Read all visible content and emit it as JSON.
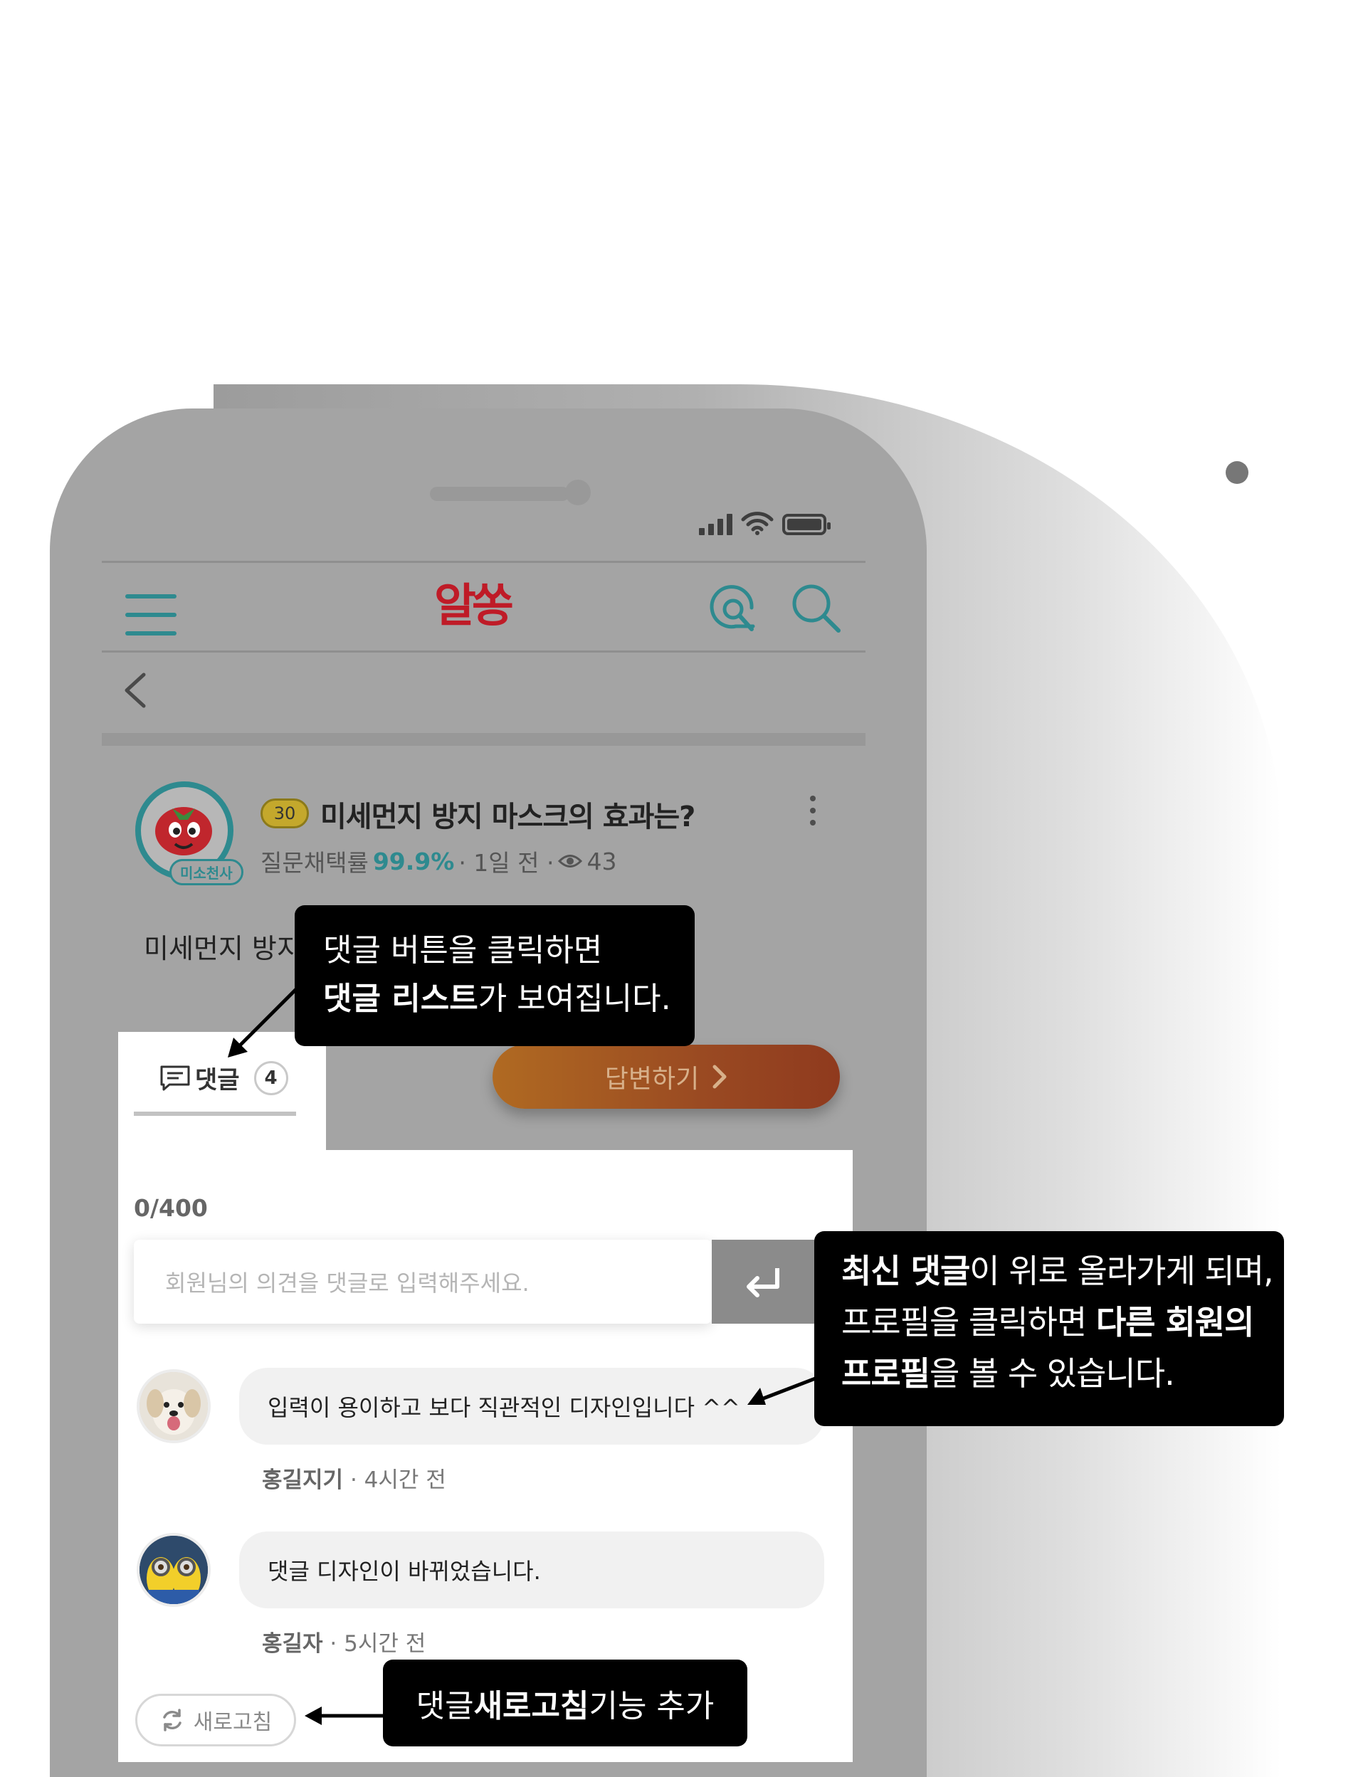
{
  "page": {
    "background": "#ffffff"
  },
  "app": {
    "logo_text": "알쏭",
    "accent_color": "#2e8a8f",
    "logo_color": "#bf1b27"
  },
  "header": {
    "menu_icon": "hamburger-icon",
    "qa_icon": "qa-search-icon",
    "search_icon": "search-icon",
    "back_icon": "back-chevron-icon"
  },
  "post": {
    "author_badge": "미소천사",
    "point_badge": "30",
    "title": "미세먼지 방지 마스크의 효과는?",
    "meta_label": "질문채택률",
    "meta_rate": "99.9%",
    "meta_time": "· 1일 전 ·",
    "views": "43",
    "body": "미세먼지 방지"
  },
  "comment_tab": {
    "label": "댓글",
    "count": "4"
  },
  "answer_button": {
    "label": "답변하기"
  },
  "comment_form": {
    "char_count": "0/400",
    "placeholder": "회원님의 의견을 댓글로 입력해주세요.",
    "send_icon": "enter-icon"
  },
  "comments": [
    {
      "text": "입력이 용이하고 보다 직관적인 디자인입니다 ^^",
      "author": "홍길지기",
      "time": "· 4시간 전"
    },
    {
      "text": "댓글 디자인이 바뀌었습니다.",
      "author": "홍길자",
      "time": "· 5시간 전"
    }
  ],
  "refresh_button": {
    "label": "새로고침"
  },
  "callouts": {
    "c1_line1": "댓글 버튼을 클릭하면",
    "c1_line2_bold": "댓글 리스트",
    "c1_line2_rest": "가 보여집니다.",
    "c2_line1_bold": "최신 댓글",
    "c2_line1_rest": "이 위로 올라가게 되며,",
    "c2_line2_plain": "프로필을 클릭하면 ",
    "c2_line2_bold": "다른 회원의",
    "c2_line3_bold": "프로필",
    "c2_line3_rest": "을 볼 수 있습니다.",
    "c3_plain1": "댓글 ",
    "c3_bold": "새로고침",
    "c3_plain2": " 기능 추가"
  }
}
